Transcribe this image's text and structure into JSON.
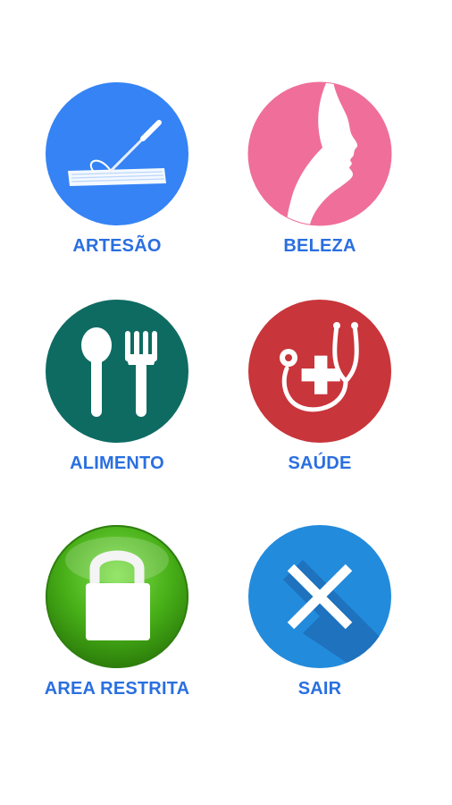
{
  "menu": {
    "items": [
      {
        "id": "artesao",
        "label": "ARTESÃO",
        "icon": "needle-thread-icon",
        "color": "#3583f5"
      },
      {
        "id": "beleza",
        "label": "BELEZA",
        "icon": "woman-profile-icon",
        "color": "#ef6f9a"
      },
      {
        "id": "alimento",
        "label": "ALIMENTO",
        "icon": "spoon-fork-icon",
        "color": "#0e6b62"
      },
      {
        "id": "saude",
        "label": "SAÚDE",
        "icon": "stethoscope-icon",
        "color": "#c8353a"
      },
      {
        "id": "area",
        "label": "AREA RESTRITA",
        "icon": "lock-icon",
        "color": "#4db31c"
      },
      {
        "id": "sair",
        "label": "SAIR",
        "icon": "close-x-icon",
        "color": "#238bdc"
      }
    ]
  },
  "colors": {
    "label": "#2a6fe0",
    "background": "#ffffff"
  }
}
